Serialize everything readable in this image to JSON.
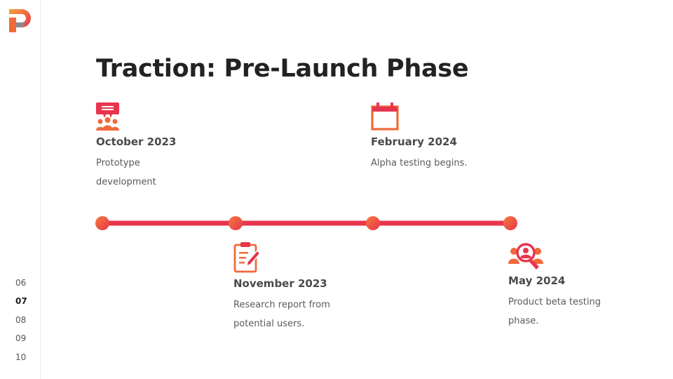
{
  "title": "Traction: Pre-Launch Phase",
  "colors": {
    "accent": "#e8354d",
    "accent_orange": "#f06a3a",
    "title": "#222222",
    "text": "#5a5a5a",
    "logo_gray": "#777777"
  },
  "milestones": [
    {
      "date": "October 2023",
      "desc_line1": "Prototype",
      "desc_line2": "development",
      "icon": "team-presentation-icon"
    },
    {
      "date": "November 2023",
      "desc_line1": "Research report from",
      "desc_line2": "potential users.",
      "icon": "clipboard-edit-icon"
    },
    {
      "date": "February 2024",
      "desc_line1": "Alpha testing begins.",
      "desc_line2": "",
      "icon": "calendar-icon"
    },
    {
      "date": "May 2024",
      "desc_line1": "Product beta testing",
      "desc_line2": "phase.",
      "icon": "user-search-icon"
    }
  ],
  "page_nav": {
    "pages": [
      "06",
      "07",
      "08",
      "09",
      "10"
    ],
    "active": "07"
  }
}
